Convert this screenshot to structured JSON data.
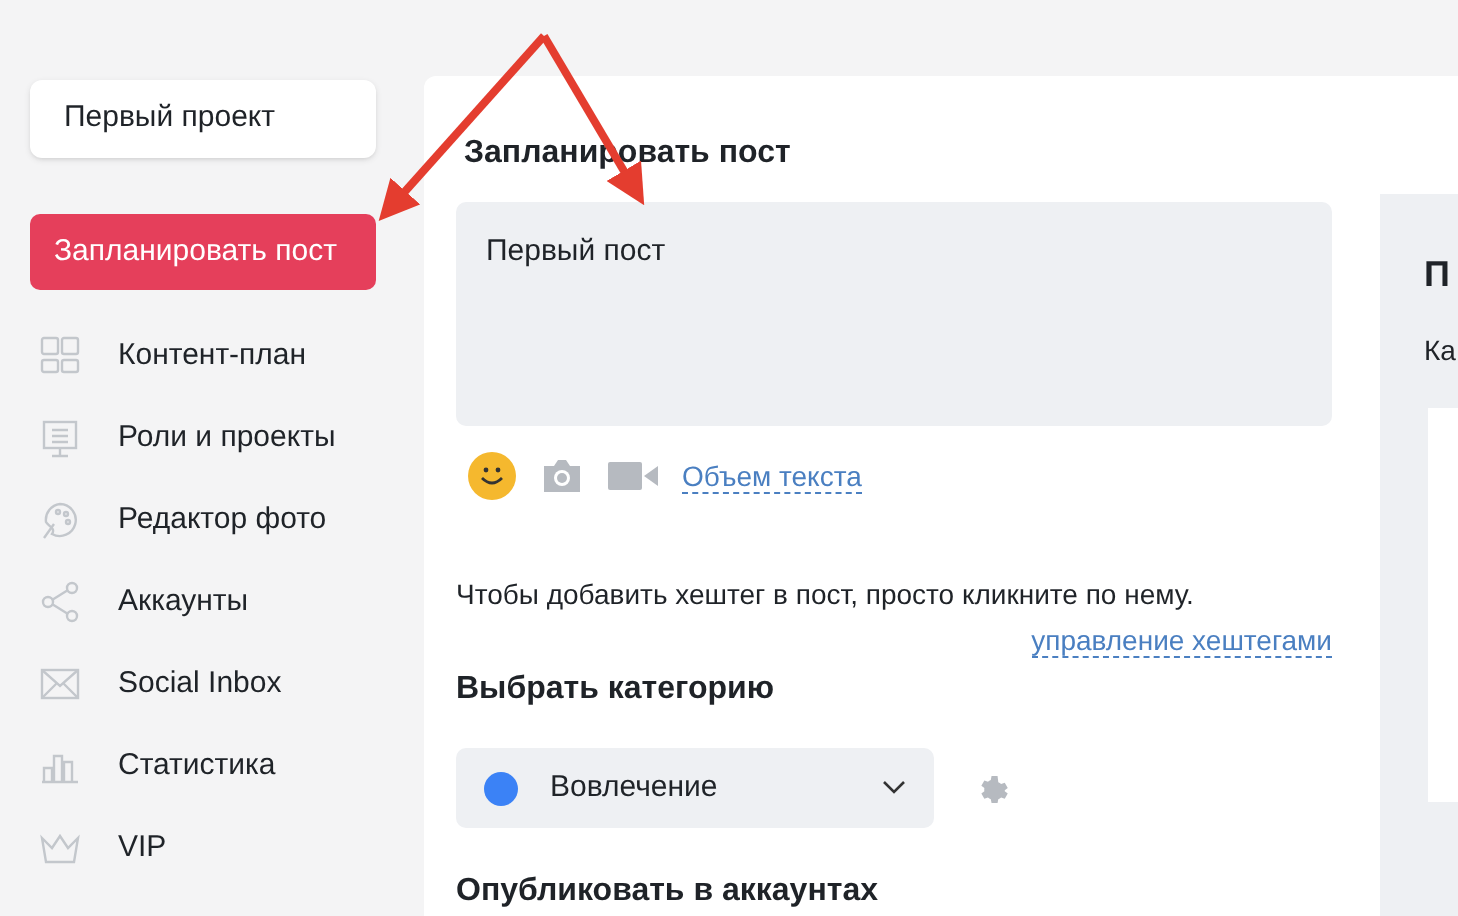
{
  "sidebar": {
    "project": "Первый проект",
    "schedule_button": "Запланировать пост",
    "items": [
      {
        "label": "Контент-план"
      },
      {
        "label": "Роли и проекты"
      },
      {
        "label": "Редактор фото"
      },
      {
        "label": "Аккаунты"
      },
      {
        "label": "Social Inbox"
      },
      {
        "label": "Статистика"
      },
      {
        "label": "VIP"
      }
    ]
  },
  "editor": {
    "title": "Запланировать пост",
    "post_text": "Первый пост",
    "text_volume_link": "Объем текста",
    "hashtag_hint": "Чтобы добавить хештег в пост, просто кликните по нему.",
    "hashtag_manage_link": "управление хештегами",
    "category_heading": "Выбрать категорию",
    "category": {
      "label": "Вовлечение",
      "color": "#3b82f6"
    },
    "publish_heading": "Опубликовать в аккаунтах"
  },
  "preview_panel": {
    "title": "П",
    "subtitle": "Ка"
  }
}
